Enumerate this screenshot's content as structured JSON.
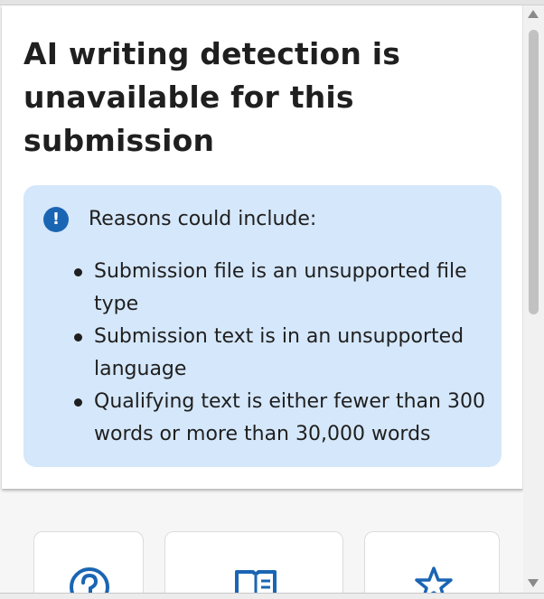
{
  "panel": {
    "title": "AI writing detection is unavailable for this submission",
    "notice": {
      "icon": "info-icon",
      "heading": "Reasons could include:",
      "reasons": [
        "Submission file is an unsupported file type",
        "Submission text is in an unsupported language",
        "Qualifying text is either fewer than 300 words or more than 30,000 words"
      ],
      "background_color": "#d5e7fa",
      "icon_color": "#1a65b3"
    }
  },
  "cards": [
    {
      "icon": "help-circle-icon"
    },
    {
      "icon": "book-icon"
    },
    {
      "icon": "star-icon"
    }
  ],
  "accent_color": "#1a65b3",
  "scrollbar": {
    "thumb_color": "#c1c1c1"
  }
}
